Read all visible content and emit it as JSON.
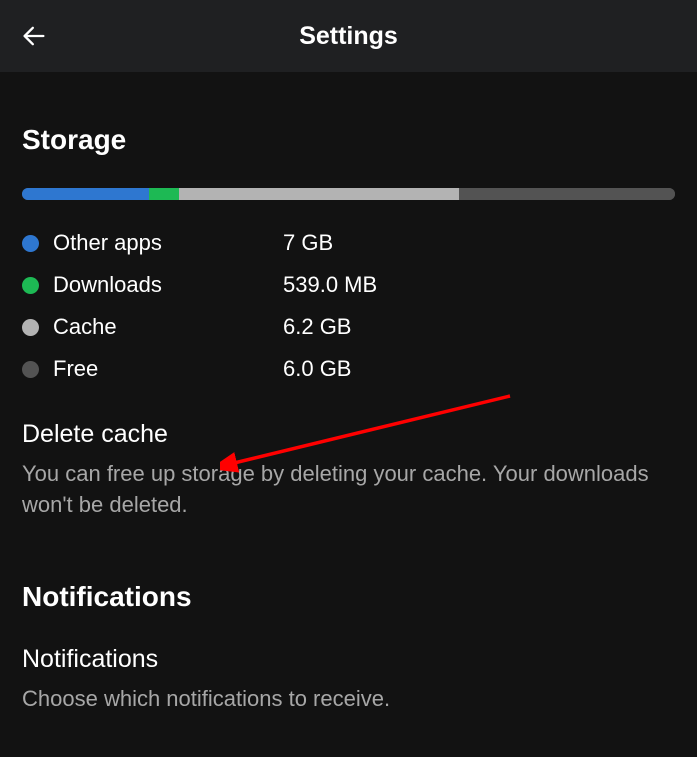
{
  "header": {
    "title": "Settings"
  },
  "storage": {
    "section_title": "Storage",
    "bar": {
      "segments": [
        {
          "color": "#2e77d0",
          "percent": 19.5
        },
        {
          "color": "#1db954",
          "percent": 4.5
        },
        {
          "color": "#b3b3b3",
          "percent": 43
        },
        {
          "color": "#535353",
          "percent": 33
        }
      ]
    },
    "legend": [
      {
        "color": "#2e77d0",
        "label": "Other apps",
        "value": "7 GB"
      },
      {
        "color": "#1db954",
        "label": "Downloads",
        "value": "539.0 MB"
      },
      {
        "color": "#b3b3b3",
        "label": "Cache",
        "value": "6.2 GB"
      },
      {
        "color": "#535353",
        "label": "Free",
        "value": "6.0 GB"
      }
    ],
    "delete_cache": {
      "label": "Delete cache",
      "desc": "You can free up storage by deleting your cache. Your downloads won't be deleted."
    }
  },
  "notifications": {
    "section_title": "Notifications",
    "item": {
      "label": "Notifications",
      "desc": "Choose which notifications to receive."
    }
  },
  "chart_data": {
    "type": "bar",
    "title": "Storage",
    "series": [
      {
        "name": "Other apps",
        "value_label": "7 GB",
        "value_gb": 7.0,
        "color": "#2e77d0"
      },
      {
        "name": "Downloads",
        "value_label": "539.0 MB",
        "value_gb": 0.539,
        "color": "#1db954"
      },
      {
        "name": "Cache",
        "value_label": "6.2 GB",
        "value_gb": 6.2,
        "color": "#b3b3b3"
      },
      {
        "name": "Free",
        "value_label": "6.0 GB",
        "value_gb": 6.0,
        "color": "#535353"
      }
    ]
  }
}
